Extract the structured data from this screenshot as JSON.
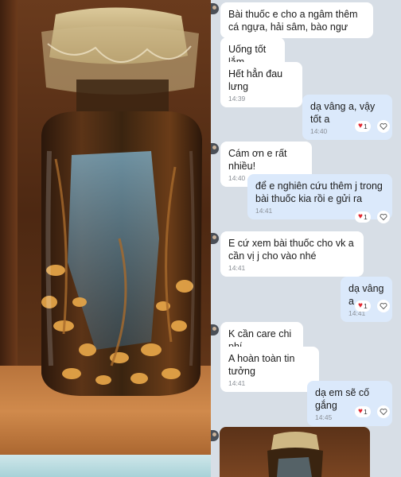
{
  "chat": {
    "messages": [
      {
        "id": "m1",
        "direction": "in",
        "text": "Bài thuốc e cho a ngâm thêm cá ngựa, hải sâm, bào ngư",
        "time": ""
      },
      {
        "id": "m2",
        "direction": "in",
        "text": "Uống tốt lắm",
        "time": ""
      },
      {
        "id": "m3",
        "direction": "in",
        "text": "Hết hẳn đau lưng",
        "time": "14:39"
      },
      {
        "id": "m4",
        "direction": "out",
        "text": "dạ vâng a, vậy tốt a",
        "time": "14:40",
        "reaction": {
          "icon": "heart",
          "count": "1"
        }
      },
      {
        "id": "m5",
        "direction": "in",
        "text": "Cám ơn e rất nhiều!",
        "time": "14:40"
      },
      {
        "id": "m6",
        "direction": "out",
        "text": "để e nghiên cứu thêm j trong bài thuốc kia rồi e gửi ra",
        "time": "14:41",
        "reaction": {
          "icon": "heart",
          "count": "1"
        }
      },
      {
        "id": "m7",
        "direction": "in",
        "text": "E cứ xem bài thuốc cho vk a cần vị j cho vào nhé",
        "time": "14:41"
      },
      {
        "id": "m8",
        "direction": "out",
        "text": "dạ vâng a",
        "time": "14:41",
        "reaction": {
          "icon": "heart",
          "count": "1"
        }
      },
      {
        "id": "m9",
        "direction": "in",
        "text": "K cần care chi phí",
        "time": ""
      },
      {
        "id": "m10",
        "direction": "in",
        "text": "A hoàn toàn tin tưởng",
        "time": "14:41"
      },
      {
        "id": "m11",
        "direction": "out",
        "text": "dạ em sẽ cố gắng",
        "time": "14:45",
        "reaction": {
          "icon": "heart",
          "count": "1"
        }
      }
    ]
  },
  "colors": {
    "incoming_bubble": "#ffffff",
    "outgoing_bubble": "#dbe9fb",
    "chat_background": "#d7dee6",
    "reaction_heart": "#e3262f",
    "timestamp": "#8a8f96"
  }
}
